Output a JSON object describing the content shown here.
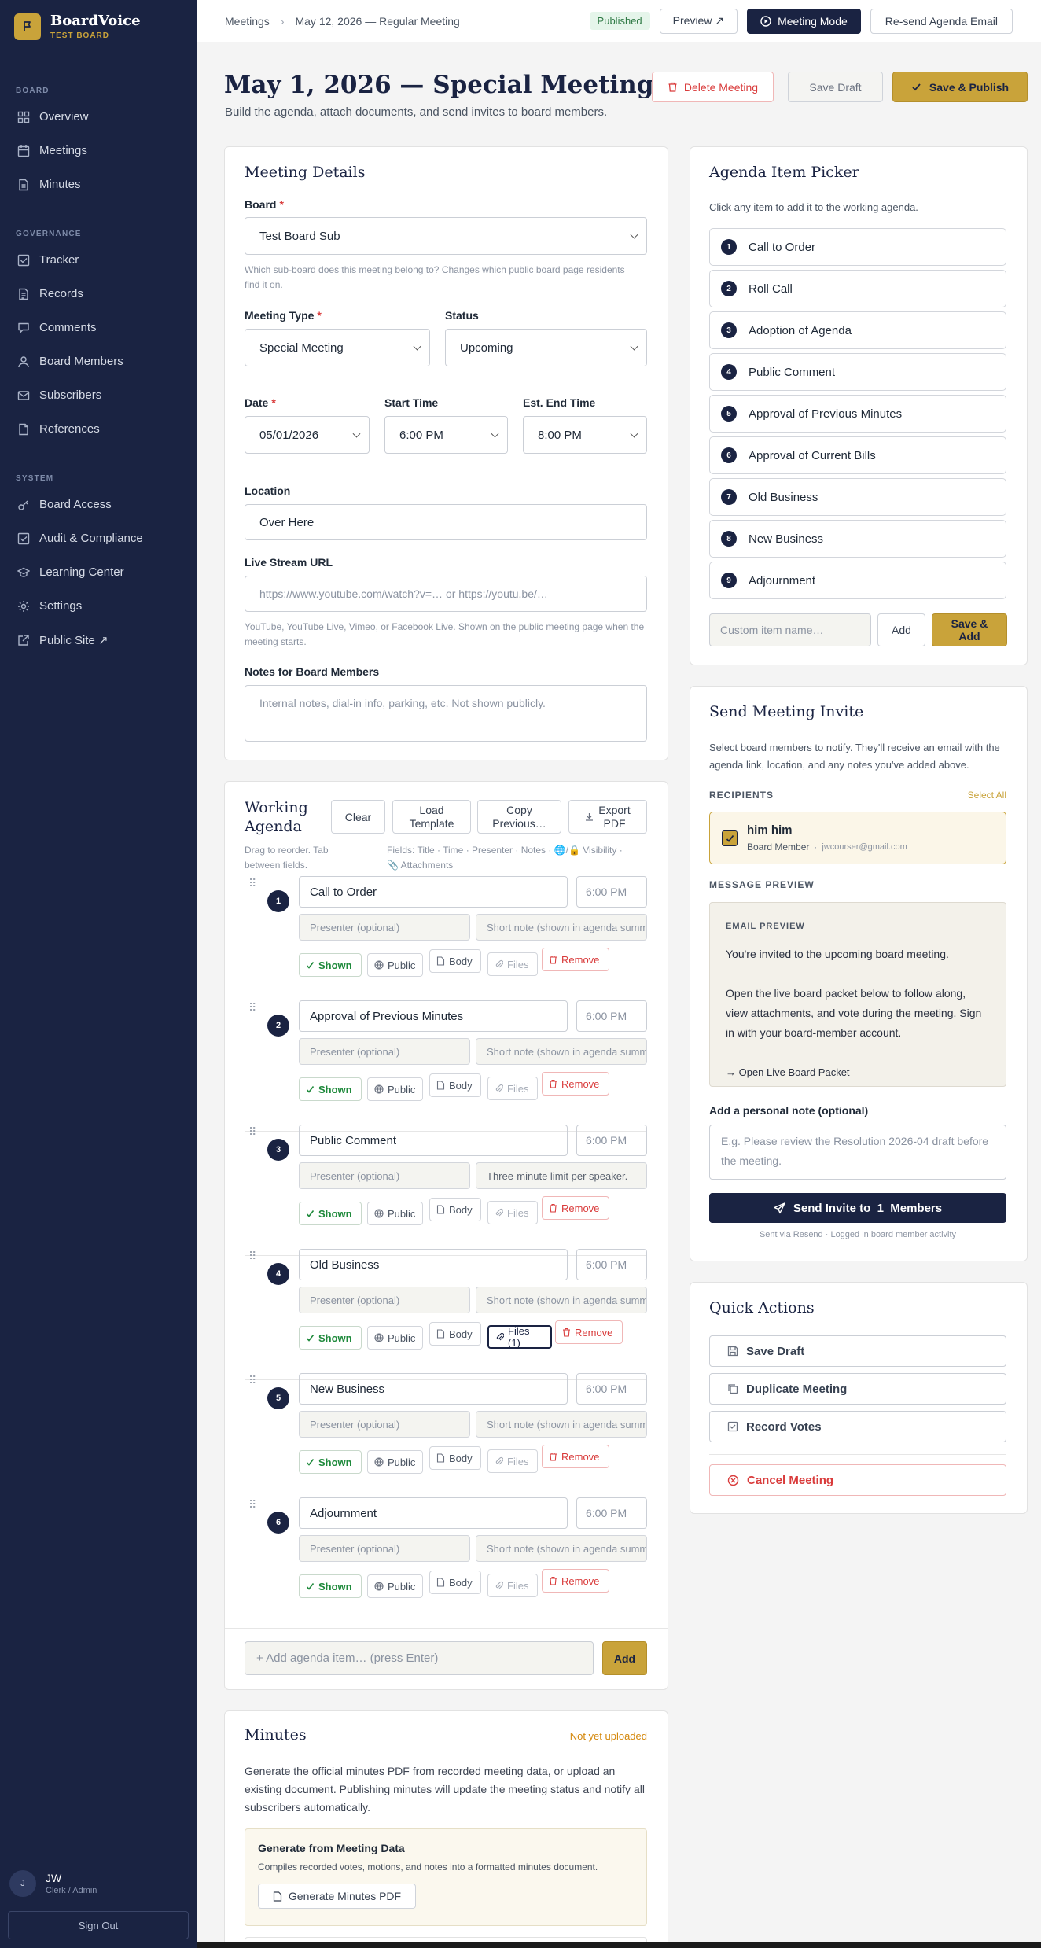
{
  "brand": {
    "name": "BoardVoice",
    "sub": "TEST BOARD"
  },
  "nav": {
    "sections": [
      {
        "label": "BOARD",
        "items": [
          "Overview",
          "Meetings",
          "Minutes"
        ]
      },
      {
        "label": "GOVERNANCE",
        "items": [
          "Tracker",
          "Records",
          "Comments",
          "Board Members",
          "Subscribers",
          "References"
        ]
      },
      {
        "label": "SYSTEM",
        "items": [
          "Board Access",
          "Audit & Compliance",
          "Learning Center",
          "Settings",
          "Public Site ↗"
        ]
      }
    ]
  },
  "user": {
    "initials": "J",
    "name": "JW",
    "role": "Clerk / Admin",
    "signout": "Sign Out"
  },
  "topbar": {
    "crumb1": "Meetings",
    "crumb2": "May 12, 2026 — Regular Meeting",
    "status": "Published",
    "preview": "Preview ↗",
    "meeting_mode": "Meeting Mode",
    "resend": "Re-send Agenda Email"
  },
  "header": {
    "title": "May 1, 2026 — Special Meeting",
    "subtitle": "Build the agenda, attach documents, and send invites to board members.",
    "delete": "Delete Meeting",
    "save_draft": "Save Draft",
    "save_publish": "Save & Publish"
  },
  "details": {
    "title": "Meeting Details",
    "board_label": "Board",
    "board_value": "Test Board Sub",
    "board_help": "Which sub-board does this meeting belong to? Changes which public board page residents find it on.",
    "type_label": "Meeting Type",
    "type_value": "Special Meeting",
    "status_label": "Status",
    "status_value": "Upcoming",
    "date_label": "Date",
    "date_value": "05/01/2026",
    "start_label": "Start Time",
    "start_value": "6:00 PM",
    "end_label": "Est. End Time",
    "end_value": "8:00 PM",
    "location_label": "Location",
    "location_value": "Over Here",
    "stream_label": "Live Stream URL",
    "stream_placeholder": "https://www.youtube.com/watch?v=… or https://youtu.be/…",
    "stream_help": "YouTube, YouTube Live, Vimeo, or Facebook Live. Shown on the public meeting page when the meeting starts.",
    "notes_label": "Notes for Board Members",
    "notes_placeholder": "Internal notes, dial-in info, parking, etc. Not shown publicly."
  },
  "agenda": {
    "title_line1": "Working",
    "title_line2": "Agenda",
    "clear": "Clear",
    "load_line1": "Load",
    "load_line2": "Template",
    "copy_line1": "Copy",
    "copy_line2": "Previous…",
    "export_line1": "Export",
    "export_line2": "PDF",
    "help_line1": "Drag to reorder. Tab",
    "help_line2": "between fields.",
    "fields_line1": "Fields: Title · Time · Presenter · Notes · 🌐/🔒 Visibility ·",
    "fields_line2": "📎 Attachments",
    "presenter_placeholder": "Presenter (optional)",
    "note_placeholder": "Short note (shown in agenda summary)",
    "shown": "Shown",
    "public": "Public",
    "body": "Body",
    "files": "Files",
    "remove": "Remove",
    "items": [
      {
        "num": "1",
        "title": "Call to Order",
        "time": "6:00 PM",
        "note": "",
        "files": "Files"
      },
      {
        "num": "2",
        "title": "Approval of Previous Minutes",
        "time": "6:00 PM",
        "note": "",
        "files": "Files"
      },
      {
        "num": "3",
        "title": "Public Comment",
        "time": "6:00 PM",
        "note": "Three-minute limit per speaker.",
        "files": "Files"
      },
      {
        "num": "4",
        "title": "Old Business",
        "time": "6:00 PM",
        "note": "",
        "files": "Files (1)"
      },
      {
        "num": "5",
        "title": "New Business",
        "time": "6:00 PM",
        "note": "",
        "files": "Files"
      },
      {
        "num": "6",
        "title": "Adjournment",
        "time": "6:00 PM",
        "note": "",
        "files": "Files"
      }
    ],
    "add_placeholder": "+ Add agenda item… (press Enter)",
    "add": "Add"
  },
  "minutes": {
    "title": "Minutes",
    "status": "Not yet uploaded",
    "desc": "Generate the official minutes PDF from recorded meeting data, or upload an existing document. Publishing minutes will update the meeting status and notify all subscribers automatically.",
    "gen_title": "Generate from Meeting Data",
    "gen_desc": "Compiles recorded votes, motions, and notes into a formatted minutes document.",
    "gen_button": "Generate Minutes PDF"
  },
  "picker": {
    "title": "Agenda Item Picker",
    "help": "Click any item to add it to the working agenda.",
    "items": [
      "Call to Order",
      "Roll Call",
      "Adoption of Agenda",
      "Public Comment",
      "Approval of Previous Minutes",
      "Approval of Current Bills",
      "Old Business",
      "New Business",
      "Adjournment"
    ],
    "custom_placeholder": "Custom item name…",
    "add": "Add",
    "save_add_line1": "Save &",
    "save_add_line2": "Add"
  },
  "invite": {
    "title": "Send Meeting Invite",
    "desc": "Select board members to notify. They'll receive an email with the agenda link, location, and any notes you've added above.",
    "recipients_label": "RECIPIENTS",
    "select_all": "Select All",
    "recipient_name": "him him",
    "recipient_role": "Board Member",
    "recipient_email": "jwcourser@gmail.com",
    "preview_label": "MESSAGE PREVIEW",
    "email_eyebrow": "EMAIL PREVIEW",
    "email_line1": "You're invited to the upcoming board meeting.",
    "email_line2": "Open the live board packet below to follow along, view attachments, and vote during the meeting. Sign in with your board-member account.",
    "email_link": "→ Open Live Board Packet",
    "note_label": "Add a personal note (optional)",
    "note_placeholder": "E.g. Please review the Resolution 2026-04 draft before the meeting.",
    "send": "Send Invite to  1  Members",
    "send_meta": "Sent via Resend · Logged in board member activity"
  },
  "quick": {
    "title": "Quick Actions",
    "save_draft": "Save Draft",
    "duplicate": "Duplicate Meeting",
    "record_votes": "Record Votes",
    "cancel": "Cancel Meeting"
  },
  "colors": {
    "navy": "#1a2342",
    "gold": "#c9a33a",
    "danger": "#d93b3b",
    "success": "#1f8a3c"
  }
}
